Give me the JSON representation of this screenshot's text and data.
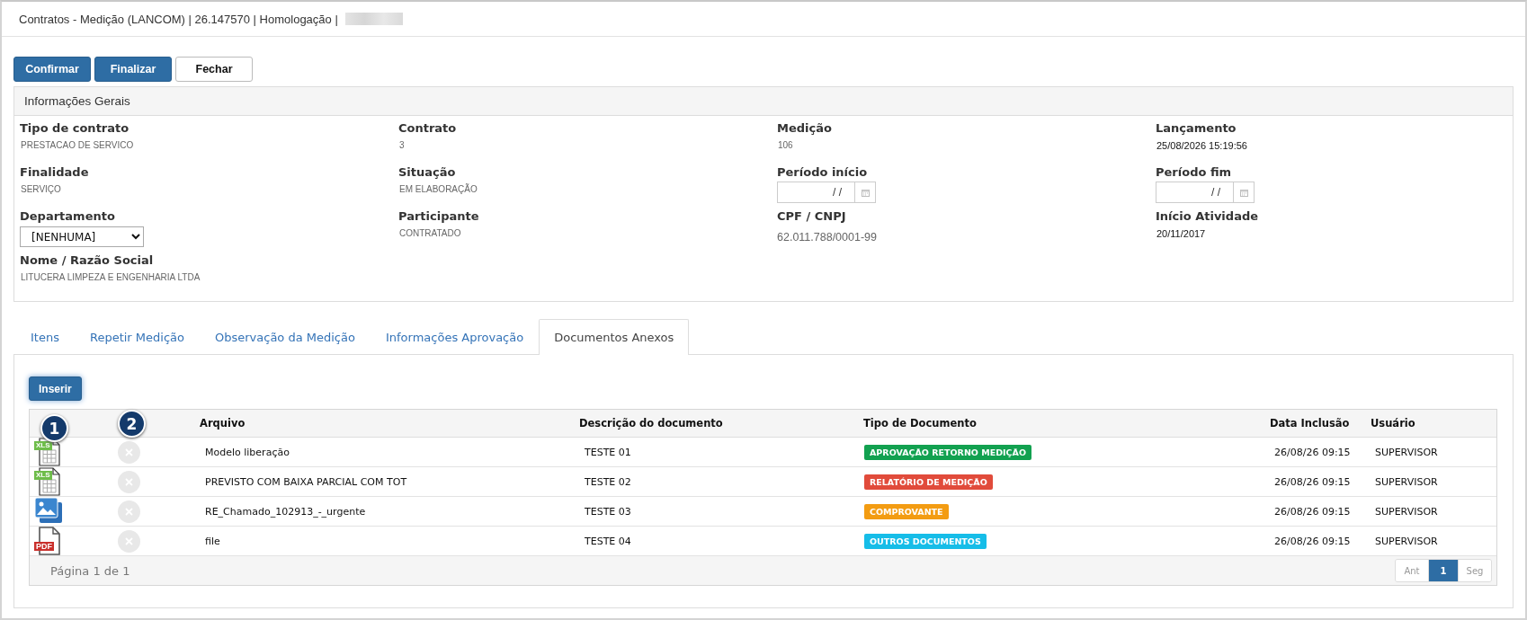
{
  "window": {
    "title": "Contratos - Medição (LANCOM) | 26.147570 | Homologação |"
  },
  "toolbar": {
    "buttons": [
      {
        "label": "Confirmar",
        "kind": "primary"
      },
      {
        "label": "Finalizar",
        "kind": "primary"
      },
      {
        "label": "Fechar",
        "kind": "default"
      }
    ]
  },
  "general_info": {
    "title": "Informações Gerais",
    "fields": [
      {
        "label": "Tipo de contrato",
        "kind": "text",
        "value": "PRESTACAO DE SERVICO"
      },
      {
        "label": "Contrato",
        "kind": "text",
        "value": "3"
      },
      {
        "label": "Medição",
        "kind": "text",
        "value": "106"
      },
      {
        "label": "Lançamento",
        "kind": "strong",
        "value": "25/08/2026 15:19:56"
      },
      {
        "label": "Finalidade",
        "kind": "text",
        "value": "SERVIÇO"
      },
      {
        "label": "Situação",
        "kind": "text",
        "value": "EM ELABORAÇÃO"
      },
      {
        "label": "Período início",
        "kind": "date",
        "value": "/ /"
      },
      {
        "label": "Período fim",
        "kind": "date",
        "value": "/ /"
      },
      {
        "label": "Departamento",
        "kind": "select",
        "value": "[NENHUMA]"
      },
      {
        "label": "Participante",
        "kind": "text",
        "value": "CONTRATADO"
      },
      {
        "label": "CPF / CNPJ",
        "kind": "large",
        "value": "62.011.788/0001-99"
      },
      {
        "label": "Início Atividade",
        "kind": "strong",
        "value": "20/11/2017"
      },
      {
        "label": "Nome / Razão Social",
        "kind": "text",
        "value": "LITUCERA LIMPEZA E ENGENHARIA LTDA"
      }
    ]
  },
  "tabs": [
    {
      "label": "Itens",
      "selected": false
    },
    {
      "label": "Repetir Medição",
      "selected": false
    },
    {
      "label": "Observação da Medição",
      "selected": false
    },
    {
      "label": "Informações Aprovação",
      "selected": false
    },
    {
      "label": "Documentos Anexos",
      "selected": true
    }
  ],
  "documents": {
    "insert_button": "Inserir",
    "columns": [
      "Arquivo",
      "Descrição do documento",
      "Tipo de Documento",
      "Data Inclusão",
      "Usuário"
    ],
    "rows": [
      {
        "kind": "spreadsheet",
        "icon_label": "XLS",
        "file": "Modelo liberação",
        "description": "TESTE 01",
        "doc_type": {
          "label": "APROVAÇÃO RETORNO MEDIÇÃO",
          "color": "#12a150"
        },
        "date": "26/08/26 09:15",
        "user": "SUPERVISOR"
      },
      {
        "kind": "spreadsheet",
        "icon_label": "XLS",
        "file": "PREVISTO COM BAIXA PARCIAL COM TOT",
        "description": "TESTE 02",
        "doc_type": {
          "label": "RELATÓRIO DE MEDIÇÃO",
          "color": "#e14b3b"
        },
        "date": "26/08/26 09:15",
        "user": "SUPERVISOR"
      },
      {
        "kind": "image",
        "file": "RE_Chamado_102913_-_urgente",
        "description": "TESTE 03",
        "doc_type": {
          "label": "COMPROVANTE",
          "color": "#f39c12"
        },
        "date": "26/08/26 09:15",
        "user": "SUPERVISOR"
      },
      {
        "kind": "pdf",
        "icon_label": "PDF",
        "file": "file",
        "description": "TESTE 04",
        "doc_type": {
          "label": "OUTROS DOCUMENTOS",
          "color": "#16bde8"
        },
        "date": "26/08/26 09:15",
        "user": "SUPERVISOR"
      }
    ],
    "page_info": "Página 1 de 1",
    "pagination": [
      {
        "label": "Ant",
        "selected": false,
        "disabled": true
      },
      {
        "label": "1",
        "selected": true,
        "disabled": false
      },
      {
        "label": "Seg",
        "selected": false,
        "disabled": true
      }
    ],
    "markers": [
      "1",
      "2"
    ]
  }
}
